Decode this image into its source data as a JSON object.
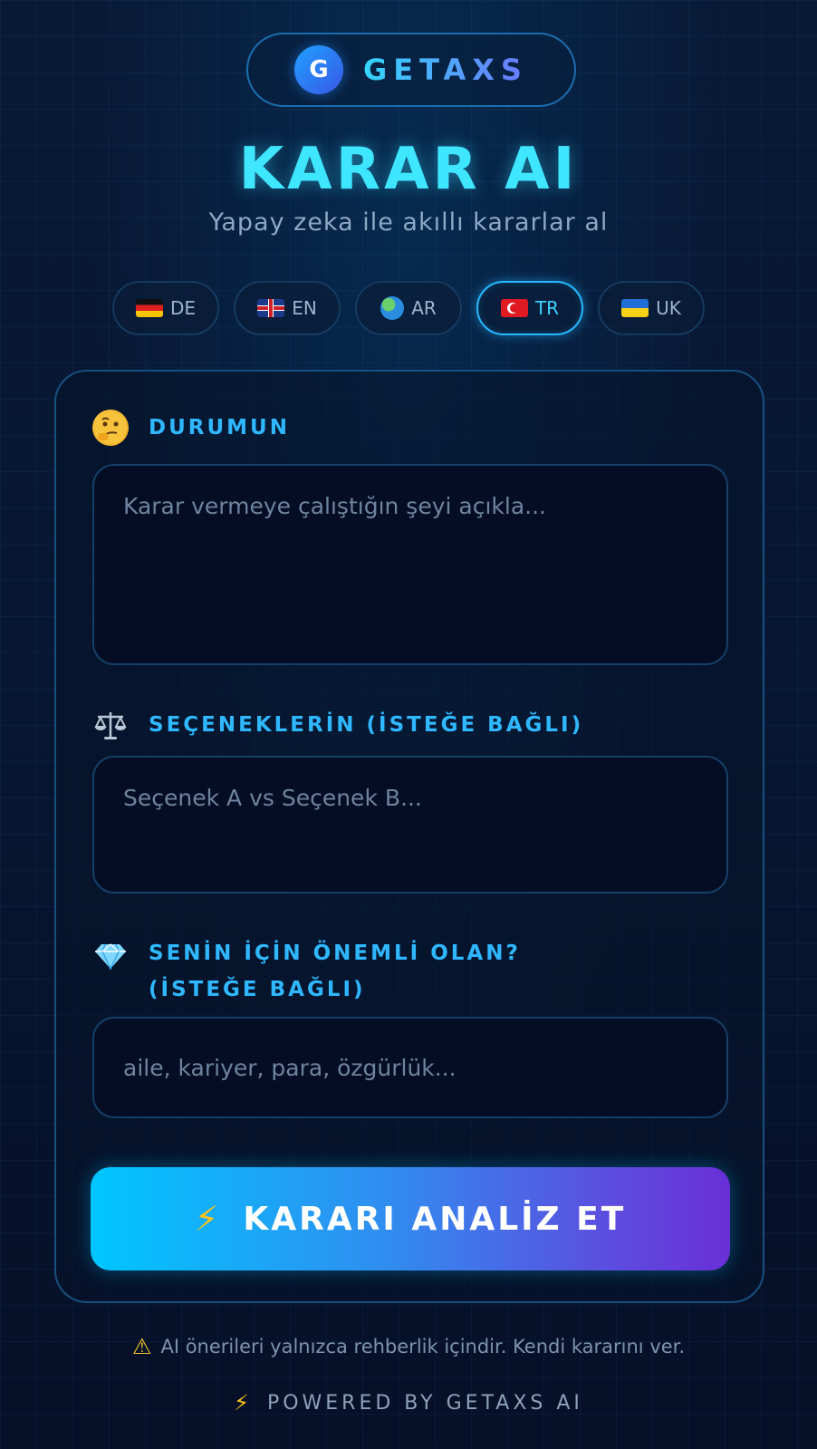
{
  "brand": {
    "logo_letter": "G",
    "name": "GETAXS"
  },
  "header": {
    "title": "KARAR AI",
    "subtitle": "Yapay zeka ile akıllı kararlar al"
  },
  "languages": [
    {
      "code": "DE",
      "icon": "germany-flag-icon",
      "active": false
    },
    {
      "code": "EN",
      "icon": "uk-flag-icon",
      "active": false
    },
    {
      "code": "AR",
      "icon": "globe-icon",
      "active": false
    },
    {
      "code": "TR",
      "icon": "turkey-flag-icon",
      "active": true
    },
    {
      "code": "UK",
      "icon": "ukraine-flag-icon",
      "active": false
    }
  ],
  "form": {
    "situation": {
      "icon": "thinking-face-icon",
      "label": "DURUMUN",
      "placeholder": "Karar vermeye çalıştığın şeyi açıkla...",
      "value": ""
    },
    "options": {
      "icon": "balance-scale-icon",
      "label": "SEÇENEKLERİN (İSTEĞE BAĞLI)",
      "placeholder": "Seçenek A vs Seçenek B...",
      "value": ""
    },
    "priorities": {
      "icon": "gem-icon",
      "label_line1": "SENİN İÇİN ÖNEMLİ OLAN?",
      "label_line2": "(İSTEĞE BAĞLI)",
      "placeholder": "aile, kariyer, para, özgürlük...",
      "value": ""
    },
    "submit_label": "KARARI ANALİZ ET"
  },
  "footer": {
    "disclaimer": "AI önerileri yalnızca rehberlik içindir. Kendi kararını ver.",
    "powered_by": "POWERED BY GETAXS AI"
  },
  "colors": {
    "accent": "#3ee6ff",
    "label": "#2fb7ff",
    "button_start": "#00c6ff",
    "button_end": "#6a2fd8"
  }
}
